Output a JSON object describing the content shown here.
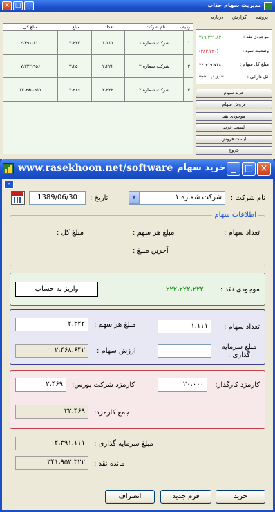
{
  "main_window": {
    "title": "مدیریت سهام جذاب",
    "menu": [
      "پرونده",
      "گزارش",
      "درباره"
    ],
    "table": {
      "columns": [
        "ردیف",
        "نام شرکت",
        "تعداد",
        "مبلغ",
        "مبلغ کل"
      ],
      "rows": [
        [
          "۱",
          "شرکت شماره ۱",
          "۱،۱۱۱",
          "۲،۲۲۲",
          "۲،۳۹۱،۱۱۱"
        ],
        [
          "۲",
          "شرکت شماره ۲",
          "۲،۲۲۲",
          "۳،۲۵۰",
          "۷،۲۲۲،۹۵۶"
        ],
        [
          "۳",
          "شرکت شماره ۲",
          "۲،۲۲۲",
          "۲،۴۶۶",
          "۱۲،۴۸۵،۹۱۱"
        ]
      ]
    },
    "info": {
      "cash_label": "موجودی نقد :",
      "cash_value": "۳۱۹،۲۲۱،۸۲۰",
      "profit_label": "وضعیت سود :",
      "profit_value": "(۲۸۲،۲۴۰)",
      "stock_total_label": "مبلغ کل سهام :",
      "stock_total_value": "۲۲،۴۱۹،۷۷۸",
      "assets_label": "کل دارائی :",
      "assets_value": "۳۴۲،۰۱۱،۸۰۲"
    },
    "side_buttons": [
      "خرید سهام",
      "فروش سهام",
      "موجودی نقد",
      "لیست خرید",
      "لیست فروش",
      "خروج"
    ]
  },
  "dialog": {
    "title": "خرید سهام",
    "watermark": "www.rasekhoon.net/software",
    "company_label": "نام شرکت :",
    "company_value": "شرکت شماره ۱",
    "date_label": "تاریخ :",
    "date_value": "1389/06/30",
    "stock_info": {
      "legend": "اطلاعات سهام",
      "count_label": "تعداد سهام :",
      "price_label": "مبلغ هر سهم :",
      "total_label": "مبلغ کل :",
      "last_label": "آخرین مبلغ :"
    },
    "cash": {
      "label": "موجودی نقد :",
      "value": "۲۲۲،۲۲۲،۲۲۲",
      "deposit_button": "واریز به حساب"
    },
    "purchase": {
      "count_label": "تعداد سهام :",
      "count_value": "۱،۱۱۱",
      "price_label": "مبلغ هر سهم :",
      "price_value": "۲،۲۲۲",
      "invest_label": "مبلغ سرمایه گذاری :",
      "invest_value": "",
      "value_label": "ارزش سهام :",
      "value_value": "۲،۴۶۸،۶۴۲"
    },
    "fees": {
      "broker_label": "کارمزد کارگذار:",
      "broker_value": "۲۰،۰۰۰",
      "exchange_label": "کارمزد شرکت بورس:",
      "exchange_value": "۲،۴۶۹",
      "sum_label": "جمع کارمزد:",
      "sum_value": "۲۲،۴۶۹"
    },
    "summary": {
      "invest_label": "مبلغ سرمایه گذاری :",
      "invest_value": "۲،۳۹۱،۱۱۱",
      "remain_label": "مانده نقد :",
      "remain_value": "۳۴۱،۹۵۲،۳۲۲"
    },
    "buttons": {
      "buy": "خرید",
      "new_form": "فرم جدید",
      "cancel": "انصراف"
    }
  }
}
